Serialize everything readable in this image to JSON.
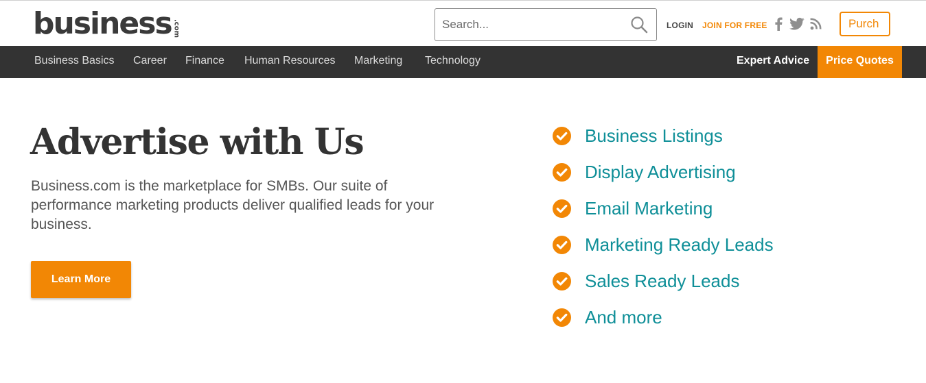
{
  "header": {
    "logo_text": "business",
    "logo_suffix": ".com",
    "search_placeholder": "Search...",
    "login_label": "LOGIN",
    "join_label": "JOIN FOR FREE",
    "social_icons": [
      "facebook-icon",
      "twitter-icon",
      "rss-icon"
    ],
    "purch_label": "Purch"
  },
  "nav": {
    "items": [
      {
        "label": "Business Basics"
      },
      {
        "label": "Career"
      },
      {
        "label": "Finance"
      },
      {
        "label": "Human Resources"
      },
      {
        "label": "Marketing"
      },
      {
        "label": "Technology"
      }
    ],
    "expert_label": "Expert Advice",
    "quotes_label": "Price Quotes"
  },
  "hero": {
    "title": "Advertise with Us",
    "intro": "Business.com is the marketplace for SMBs. Our suite of performance marketing products deliver qualified leads for your business.",
    "cta_label": "Learn More"
  },
  "products": [
    {
      "label": "Business Listings"
    },
    {
      "label": "Display Advertising"
    },
    {
      "label": "Email Marketing"
    },
    {
      "label": "Marketing Ready Leads"
    },
    {
      "label": "Sales Ready Leads"
    },
    {
      "label": "And more"
    }
  ],
  "colors": {
    "accent": "#f28705",
    "nav_bg": "#333333",
    "link_teal": "#0f8f98",
    "text_dark": "#333333"
  }
}
